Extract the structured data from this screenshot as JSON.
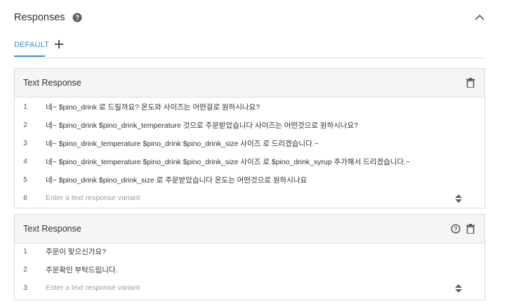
{
  "header": {
    "title": "Responses",
    "help_icon": "help-circle-icon",
    "collapse_icon": "chevron-up-icon"
  },
  "tabs": [
    {
      "label": "DEFAULT",
      "active": true
    }
  ],
  "add_tab_icon": "plus-icon",
  "colors": {
    "accent": "#3a8ed8",
    "card_header_bg": "#f5f5f5",
    "border": "#dadada"
  },
  "cards": [
    {
      "title": "Text Response",
      "icons": [
        "trash-icon"
      ],
      "rows": [
        {
          "num": "1",
          "text": "네~ $pino_drink  로 드릴까요? 온도와 사이즈는 어떤걸로 원하시나요?"
        },
        {
          "num": "2",
          "text": "네~ $pino_drink  $pino_drink_temperature 것으로 주문받았습니다 사이즈는 어떤것으로 원하시나요?"
        },
        {
          "num": "3",
          "text": "네~ $pino_drink_temperature $pino_drink    $pino_drink_size 사이즈 로 드리겠습니다.~"
        },
        {
          "num": "4",
          "text": "네~  $pino_drink_temperature  $pino_drink  $pino_drink_size 사이즈 로  $pino_drink_syrup 추가해서 드리겠습니다.~"
        },
        {
          "num": "5",
          "text": "네~ $pino_drink  $pino_drink_size 로 주문받았습니다 온도는 어떤것으로 원하시나요"
        }
      ],
      "new_row": {
        "num": "6",
        "placeholder": "Enter a text response variant"
      }
    },
    {
      "title": "Text Response",
      "icons": [
        "help-circle-icon",
        "trash-icon"
      ],
      "rows": [
        {
          "num": "1",
          "text": "주문이 맞으신가요?"
        },
        {
          "num": "2",
          "text": "주문확인 부탁드립니다."
        }
      ],
      "new_row": {
        "num": "3",
        "placeholder": "Enter a text response variant"
      }
    }
  ]
}
